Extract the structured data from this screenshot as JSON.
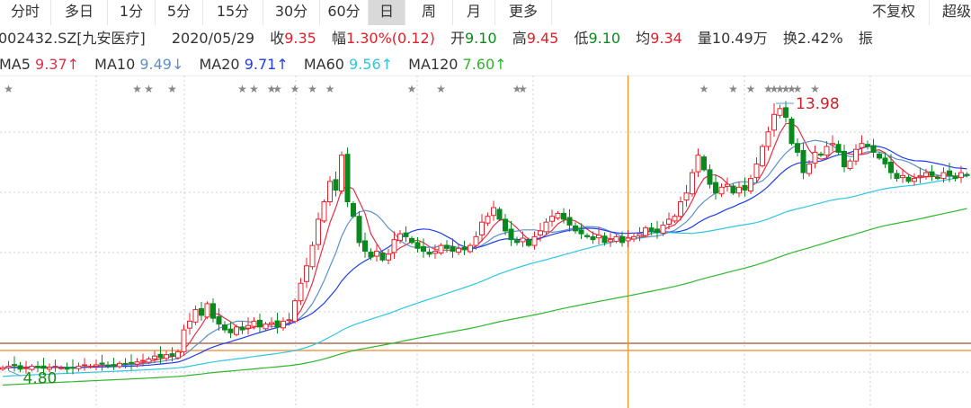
{
  "tabs": [
    {
      "label": "分时"
    },
    {
      "label": "多日"
    },
    {
      "label": "1分"
    },
    {
      "label": "5分"
    },
    {
      "label": "15分"
    },
    {
      "label": "30分"
    },
    {
      "label": "60分"
    },
    {
      "label": "日",
      "active": true
    },
    {
      "label": "周"
    },
    {
      "label": "月"
    },
    {
      "label": "更多"
    }
  ],
  "right_tabs": [
    {
      "label": "不复权"
    },
    {
      "label": "超级"
    }
  ],
  "quote": {
    "symbol": "002432.SZ[九安医疗]",
    "date": "2020/05/29",
    "close_label": "收",
    "close": "9.35",
    "change_label": "幅",
    "change": "1.30%(0.12)",
    "open_label": "开",
    "open": "9.10",
    "high_label": "高",
    "high": "9.45",
    "low_label": "低",
    "low": "9.10",
    "avg_label": "均",
    "avg": "9.34",
    "vol_label": "量",
    "vol": "10.49万",
    "turnover_label": "换",
    "turnover": "2.42%",
    "amp_label": "振"
  },
  "ma": [
    {
      "name": "MA5",
      "value": "9.37↑",
      "color": "#e0304a"
    },
    {
      "name": "MA10",
      "value": "9.49↓",
      "color": "#5f8fc4"
    },
    {
      "name": "MA20",
      "value": "9.71↑",
      "color": "#1f3cf0"
    },
    {
      "name": "MA60",
      "value": "9.56↑",
      "color": "#2fc6e0"
    },
    {
      "name": "MA120",
      "value": "7.60↑",
      "color": "#2fb52f"
    }
  ],
  "colors": {
    "up": "#e8222d",
    "down": "#0a8a1e",
    "grid": "#cfcfcf",
    "crosshair": "#f0902a"
  },
  "chart_data": {
    "type": "candlestick",
    "closes": [
      4.9,
      4.95,
      5.0,
      4.85,
      4.9,
      4.95,
      4.9,
      4.88,
      4.92,
      4.95,
      4.9,
      4.85,
      4.9,
      4.95,
      5.0,
      4.95,
      5.0,
      5.02,
      4.98,
      5.0,
      5.05,
      5.02,
      5.05,
      5.1,
      5.15,
      5.2,
      5.3,
      5.25,
      5.35,
      5.3,
      5.45,
      6.2,
      6.5,
      6.9,
      6.7,
      7.1,
      6.6,
      6.4,
      6.2,
      6.1,
      6.3,
      6.2,
      6.35,
      6.5,
      6.3,
      6.4,
      6.45,
      6.3,
      6.5,
      6.55,
      7.2,
      7.8,
      8.4,
      9.1,
      10.0,
      10.6,
      11.3,
      11.0,
      12.2,
      10.6,
      10.1,
      9.2,
      8.9,
      8.7,
      8.9,
      8.6,
      8.8,
      9.3,
      9.5,
      9.4,
      9.2,
      9.0,
      8.9,
      8.8,
      8.9,
      9.1,
      9.0,
      8.9,
      9.0,
      8.95,
      9.1,
      9.4,
      9.9,
      10.1,
      10.4,
      10.0,
      9.6,
      9.3,
      9.2,
      9.35,
      9.1,
      9.4,
      9.6,
      9.9,
      10.1,
      10.2,
      10.0,
      9.8,
      9.6,
      9.5,
      9.4,
      9.3,
      9.45,
      9.2,
      9.3,
      9.4,
      9.2,
      9.35,
      9.4,
      9.5,
      9.7,
      9.6,
      9.55,
      9.8,
      10.0,
      10.1,
      10.6,
      10.9,
      11.6,
      12.2,
      11.7,
      11.2,
      10.9,
      11.1,
      11.2,
      10.9,
      11.1,
      11.0,
      11.4,
      11.9,
      12.5,
      13.0,
      13.6,
      13.8,
      13.5,
      12.6,
      12.3,
      11.6,
      11.9,
      12.3,
      12.2,
      12.5,
      12.6,
      12.3,
      11.8,
      12.0,
      12.4,
      12.6,
      12.5,
      12.3,
      12.1,
      11.9,
      11.6,
      11.4,
      11.5,
      11.3,
      11.4,
      11.5,
      11.6,
      11.5,
      11.4,
      11.6,
      11.5,
      11.4,
      11.6,
      11.5
    ],
    "high_mark": {
      "index": 132,
      "value": 13.98,
      "label": "13.98"
    },
    "low_mark": {
      "index": 1,
      "value": 4.8,
      "label": "4.80"
    },
    "crosshair_index": 107,
    "support_lines": [
      5.85,
      5.6
    ],
    "star_indices": [
      1,
      23,
      25,
      29,
      41,
      43,
      46,
      47,
      50,
      53,
      56,
      70,
      75,
      88,
      89,
      120,
      125,
      128,
      131,
      132,
      133,
      134,
      135,
      136,
      139
    ],
    "ma_periods": [
      5,
      10,
      20,
      60,
      120
    ]
  }
}
